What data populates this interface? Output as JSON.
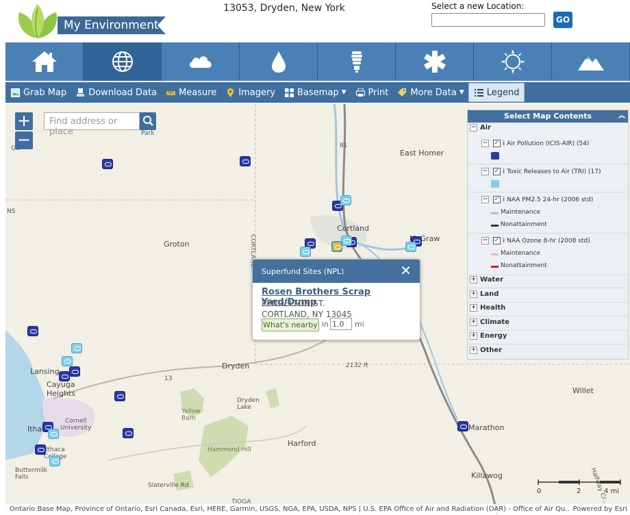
{
  "header": {
    "logo_text": "My Environment",
    "location": "13053, Dryden, New York",
    "location_label": "Select a new Location:",
    "location_value": "",
    "go_label": "GO"
  },
  "nav": {
    "items": [
      {
        "name": "home",
        "icon": "home-icon",
        "active": false
      },
      {
        "name": "globe",
        "icon": "globe-icon",
        "active": true
      },
      {
        "name": "air",
        "icon": "cloud-icon",
        "active": false
      },
      {
        "name": "water",
        "icon": "water-drop-icon",
        "active": false
      },
      {
        "name": "energy",
        "icon": "light-bulb-icon",
        "active": false
      },
      {
        "name": "health",
        "icon": "asterisk-icon",
        "active": false
      },
      {
        "name": "climate",
        "icon": "sun-icon",
        "active": false
      },
      {
        "name": "land",
        "icon": "mountain-icon",
        "active": false
      }
    ]
  },
  "toolbar": {
    "grab_map": "Grab Map",
    "download_data": "Download Data",
    "measure": "Measure",
    "imagery": "Imagery",
    "basemap": "Basemap",
    "print": "Print",
    "more_data": "More Data",
    "legend": "Legend"
  },
  "map": {
    "search_placeholder": "Find address or place",
    "zoom_in": "+",
    "zoom_out": "−",
    "places": {
      "cortland": "Cortland",
      "groton": "Groton",
      "dryden": "Dryden",
      "east_homer": "East Homer",
      "mcgraw": "McGraw",
      "dryden_lake": "Dryden\nLake",
      "yellow_barn": "Yellow\nBarn",
      "hammond_hill": "Hammond Hill",
      "harford": "Harford",
      "marathon": "Marathon",
      "willet": "Willet",
      "killawog": "Killawog",
      "lansing": "Lansing",
      "cayuga_heights": "Cayuga\nHeights",
      "cornell": "Cornell\nUniversity",
      "ithaca": "Ithaca",
      "ithaca_college": "Ithaca\nCollege",
      "buttermilk": "Buttermilk\nFalls",
      "slaterville": "Slaterville Rd",
      "tioga": "TIOGA",
      "cortland_county": "CORTLAND",
      "elevation": "2132 ft",
      "route13": "13",
      "route13b": "13",
      "route81": "81",
      "geneva": "Ge",
      "park": "Park",
      "ns": "NS",
      "halfway": "Halfway Cr..."
    },
    "popup": {
      "header": "Superfund Sites (NPL)",
      "close": "✕",
      "site_name": "Rosen Brothers Scrap Yard/Dump",
      "street": "PENDELTON ST.",
      "city": "CORTLAND, NY 13045",
      "nearby_label": "What's nearby",
      "in_label": "in",
      "distance": "1.0",
      "unit": "mi"
    },
    "scale": {
      "s0": "0",
      "s2": "2",
      "s4": "4 mi"
    },
    "attribution": "Ontario Base Map, Province of Ontario, Esri Canada, Esri, HERE, Garmin, USGS, NGA, EPA, USDA, NPS | U.S. EPA Office of Air and Radiation (OAR) - Office of Air Qu...",
    "powered_by": "Powered by Esri"
  },
  "panel": {
    "title": "Select Map Contents",
    "sections": {
      "air": "Air",
      "water": "Water",
      "land": "Land",
      "health": "Health",
      "climate": "Climate",
      "energy": "Energy",
      "other": "Other"
    },
    "layers": {
      "air_pollution": "Air Pollution (ICIS-AIR) (54)",
      "toxic_releases": "Toxic Releases to Air (TRI) (17)",
      "naa_pm25": "NAA PM2.5 24-hr (2006 std)",
      "naa_ozone": "NAA Ozone 8-hr (2008 std)"
    },
    "legend": {
      "pm_maintenance": "Maintenance",
      "pm_nonattainment": "Nonattainment",
      "oz_maintenance": "Maintenance",
      "oz_nonattainment": "Nonattainment"
    },
    "colors": {
      "pm_maintenance": "#bbbbbb",
      "pm_nonattainment": "#333333",
      "oz_maintenance": "#f4b6b6",
      "oz_nonattainment": "#d21c1c"
    }
  },
  "colors": {
    "nav_bg": "#4a80b5",
    "nav_active": "#2f6497",
    "toolbar_bg": "#3f6f9e",
    "marker_dark": "#2a39a8",
    "marker_light": "#7fd0ea",
    "logo_green": "#8ec63f"
  }
}
